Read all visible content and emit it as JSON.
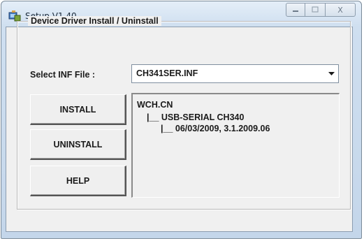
{
  "window": {
    "title": "Setup V1.40",
    "icon": "setup-app-icon",
    "controls": {
      "minimize_icon": "minimize-icon",
      "maximize_icon": "maximize-icon",
      "close_icon": "close-icon",
      "close_glyph": "X"
    }
  },
  "group": {
    "legend": "Device Driver Install / Uninstall"
  },
  "inf_selector": {
    "label": "Select INF File :",
    "selected_value": "CH341SER.INF"
  },
  "buttons": {
    "install": "INSTALL",
    "uninstall": "UNINSTALL",
    "help": "HELP"
  },
  "driver_tree": {
    "lines": [
      "WCH.CN",
      "|__ USB-SERIAL CH340",
      "|__ 06/03/2009, 3.1.2009.06"
    ]
  },
  "colors": {
    "titlebar": "#cfdff0",
    "client_background": "#f0f0f0",
    "select_background": "#ffffff"
  }
}
